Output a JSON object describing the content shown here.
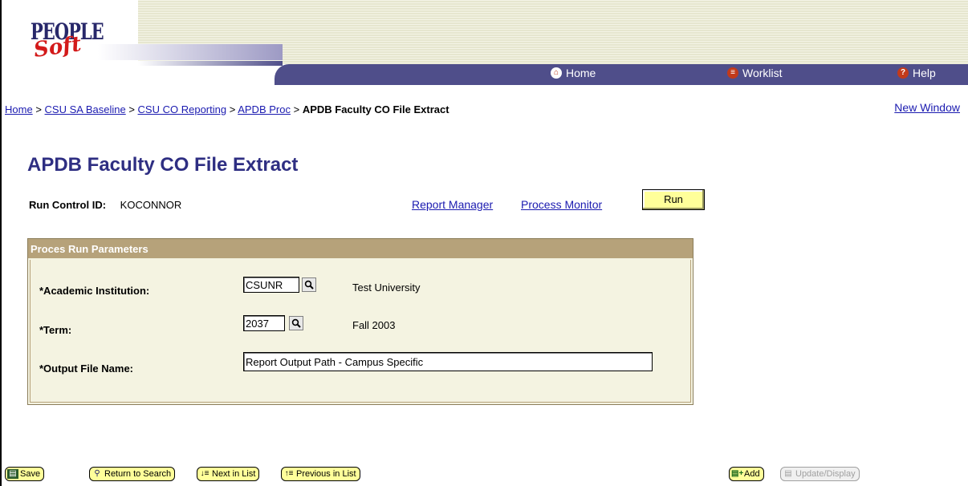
{
  "header": {
    "logo_top": "PEOPLE",
    "logo_bottom": "Soft",
    "nav": {
      "home": "Home",
      "worklist": "Worklist",
      "help": "Help"
    }
  },
  "breadcrumb": {
    "items": [
      "Home",
      "CSU SA Baseline",
      "CSU CO Reporting",
      "APDB Proc"
    ],
    "separator": ">",
    "current": "APDB Faculty CO File Extract"
  },
  "new_window": "New Window",
  "page_title": "APDB Faculty CO File Extract",
  "run_control": {
    "label": "Run Control ID:",
    "value": "KOCONNOR"
  },
  "links": {
    "report_manager": "Report Manager",
    "process_monitor": "Process Monitor"
  },
  "run_button": "Run",
  "params": {
    "header": "Proces Run Parameters",
    "institution": {
      "label": "*Academic Institution:",
      "value": "CSUNR",
      "description": "Test University"
    },
    "term": {
      "label": "*Term:",
      "value": "2037",
      "description": "Fall 2003"
    },
    "output": {
      "label": "*Output File Name:",
      "value": "Report Output Path - Campus Specific"
    }
  },
  "toolbar": {
    "save": "Save",
    "return_to_search": "Return to Search",
    "next_in_list": "Next in List",
    "previous_in_list": "Previous in List",
    "add": "Add",
    "update_display": "Update/Display"
  },
  "colors": {
    "nav_bar": "#4f4e8a",
    "title": "#2e2e82",
    "link": "#1b1bb0",
    "button": "#ffff9a",
    "group_header": "#b6a27a",
    "group_bg": "#f4f3e1"
  }
}
